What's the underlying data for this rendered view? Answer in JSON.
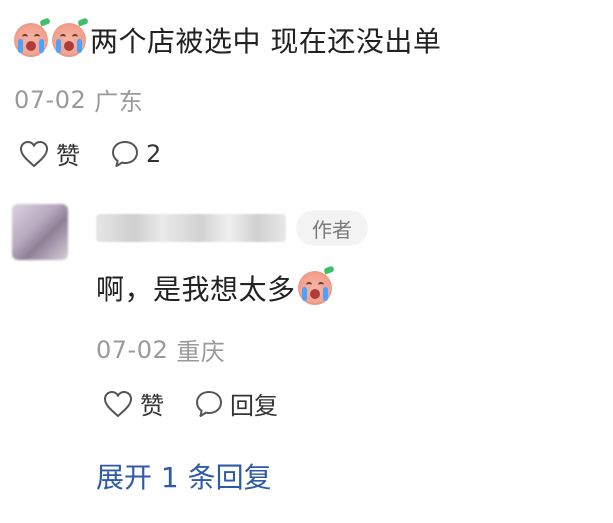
{
  "comment": {
    "text": "两个店被选中 现在还没出单",
    "date": "07-02",
    "location": "广东",
    "like_label": "赞",
    "reply_count": "2"
  },
  "reply": {
    "author_badge": "作者",
    "text": "啊，是我想太多",
    "date": "07-02",
    "location": "重庆",
    "like_label": "赞",
    "reply_label": "回复",
    "expand_label": "展开 1 条回复"
  },
  "colors": {
    "link": "#2e5aa8",
    "meta_text": "#9a9a9a",
    "main_text": "#222222",
    "badge_bg": "#f3f3f3"
  },
  "icons": {
    "emoji": "crying-face-emoji-icon",
    "like": "heart-outline-icon",
    "comment": "speech-bubble-icon"
  }
}
